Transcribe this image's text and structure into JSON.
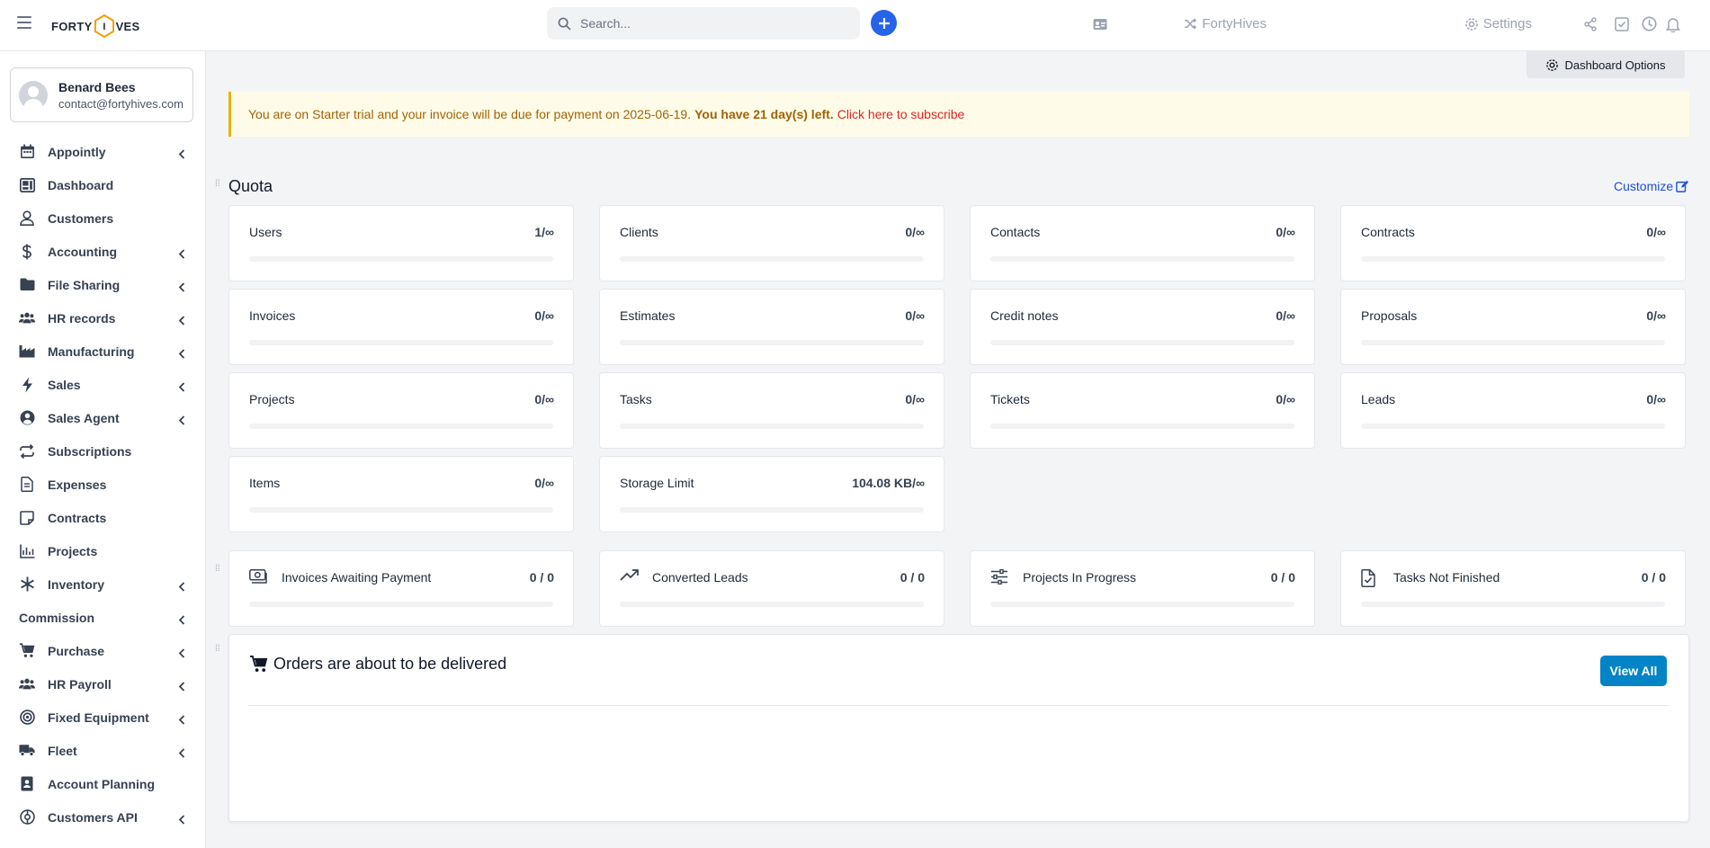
{
  "topbar": {
    "logo_left": "FORTY",
    "logo_letter": "I",
    "logo_right": "VES",
    "search_placeholder": "Search...",
    "brand_link": "FortyHives",
    "settings_label": "Settings"
  },
  "user": {
    "name": "Benard Bees",
    "email": "contact@fortyhives.com"
  },
  "sidebar": {
    "items": [
      {
        "label": "Appointly",
        "icon": "calendar-icon",
        "chevron": true
      },
      {
        "label": "Dashboard",
        "icon": "dashboard-icon",
        "chevron": false
      },
      {
        "label": "Customers",
        "icon": "user-icon",
        "chevron": false
      },
      {
        "label": "Accounting",
        "icon": "dollar-icon",
        "chevron": true
      },
      {
        "label": "File Sharing",
        "icon": "folder-icon",
        "chevron": true
      },
      {
        "label": "HR records",
        "icon": "users-icon",
        "chevron": true
      },
      {
        "label": "Manufacturing",
        "icon": "industry-icon",
        "chevron": true
      },
      {
        "label": "Sales",
        "icon": "bolt-icon",
        "chevron": true
      },
      {
        "label": "Sales Agent",
        "icon": "user-circle-icon",
        "chevron": true
      },
      {
        "label": "Subscriptions",
        "icon": "repeat-icon",
        "chevron": false
      },
      {
        "label": "Expenses",
        "icon": "file-icon",
        "chevron": false
      },
      {
        "label": "Contracts",
        "icon": "note-icon",
        "chevron": false
      },
      {
        "label": "Projects",
        "icon": "chart-icon",
        "chevron": false
      },
      {
        "label": "Inventory",
        "icon": "snowflake-icon",
        "chevron": true
      },
      {
        "label": "Commission",
        "icon": "",
        "chevron": true
      },
      {
        "label": "Purchase",
        "icon": "cart-icon",
        "chevron": true
      },
      {
        "label": "HR Payroll",
        "icon": "users-icon",
        "chevron": true
      },
      {
        "label": "Fixed Equipment",
        "icon": "target-icon",
        "chevron": true
      },
      {
        "label": "Fleet",
        "icon": "truck-icon",
        "chevron": true
      },
      {
        "label": "Account Planning",
        "icon": "contact-card-icon",
        "chevron": false
      },
      {
        "label": "Customers API",
        "icon": "api-icon",
        "chevron": true
      }
    ]
  },
  "main": {
    "dashboard_options": "Dashboard Options",
    "alert": {
      "text": "You are on Starter trial and your invoice will be due for payment on 2025-06-19.",
      "bold": "You have 21 day(s) left.",
      "link": "Click here to subscribe"
    },
    "quota_title": "Quota",
    "customize_label": "Customize",
    "quota_cards": [
      {
        "label": "Users",
        "value": "1/∞"
      },
      {
        "label": "Clients",
        "value": "0/∞"
      },
      {
        "label": "Contacts",
        "value": "0/∞"
      },
      {
        "label": "Contracts",
        "value": "0/∞"
      },
      {
        "label": "Invoices",
        "value": "0/∞"
      },
      {
        "label": "Estimates",
        "value": "0/∞"
      },
      {
        "label": "Credit notes",
        "value": "0/∞"
      },
      {
        "label": "Proposals",
        "value": "0/∞"
      },
      {
        "label": "Projects",
        "value": "0/∞"
      },
      {
        "label": "Tasks",
        "value": "0/∞"
      },
      {
        "label": "Tickets",
        "value": "0/∞"
      },
      {
        "label": "Leads",
        "value": "0/∞"
      },
      {
        "label": "Items",
        "value": "0/∞"
      },
      {
        "label": "Storage Limit",
        "value": "104.08 KB/∞"
      }
    ],
    "stat_cards": [
      {
        "label": "Invoices Awaiting Payment",
        "value": "0 / 0",
        "icon": "money-icon"
      },
      {
        "label": "Converted Leads",
        "value": "0 / 0",
        "icon": "trend-up-icon"
      },
      {
        "label": "Projects In Progress",
        "value": "0 / 0",
        "icon": "sliders-icon"
      },
      {
        "label": "Tasks Not Finished",
        "value": "0 / 0",
        "icon": "file-check-icon"
      }
    ],
    "orders": {
      "title": "Orders are about to be delivered",
      "view_all": "View All"
    }
  }
}
